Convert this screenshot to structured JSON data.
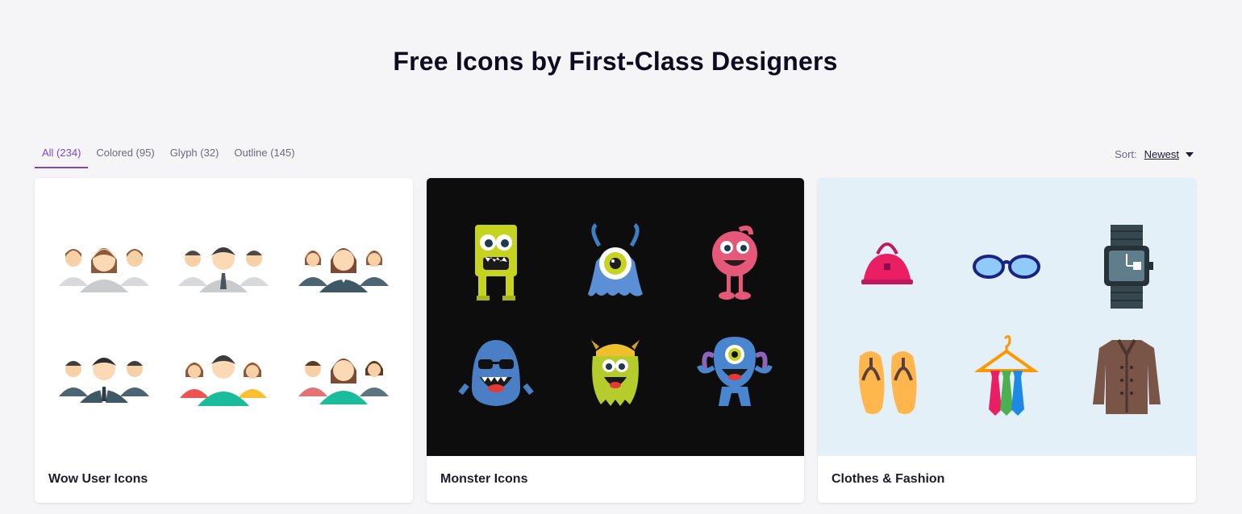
{
  "header": {
    "title": "Free Icons by First-Class Designers"
  },
  "filters": {
    "tabs": [
      {
        "label": "All (234)",
        "active": true
      },
      {
        "label": "Colored (95)",
        "active": false
      },
      {
        "label": "Glyph (32)",
        "active": false
      },
      {
        "label": "Outline (145)",
        "active": false
      }
    ]
  },
  "sort": {
    "label": "Sort:",
    "value": "Newest"
  },
  "packs": [
    {
      "title": "Wow User Icons",
      "background": "#ffffff",
      "icons": [
        "user-group-women-icon",
        "user-group-men-icon",
        "user-group-women-dark-icon",
        "user-group-men-dark-icon",
        "user-group-colored-icon",
        "user-group-colored-women-icon"
      ]
    },
    {
      "title": "Monster Icons",
      "background": "#0d0d0d",
      "icons": [
        "green-block-monster-icon",
        "blue-one-eye-monster-icon",
        "pink-monster-icon",
        "blue-sunglasses-monster-icon",
        "yellow-horned-monster-icon",
        "blue-cyclops-monster-icon"
      ]
    },
    {
      "title": "Clothes & Fashion",
      "background": "#e3f0f8",
      "icons": [
        "handbag-icon",
        "glasses-icon",
        "wristwatch-icon",
        "flip-flops-icon",
        "ties-on-hanger-icon",
        "jacket-icon"
      ]
    }
  ]
}
